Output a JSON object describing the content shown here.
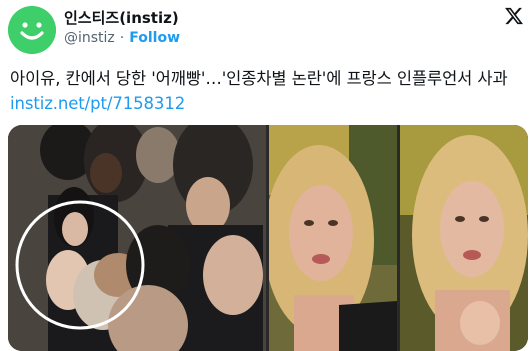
{
  "account": {
    "display_name": "인스티즈(instiz)",
    "handle": "@instiz",
    "separator": "·",
    "follow_label": "Follow",
    "avatar_color": "#3fcf6a"
  },
  "platform_icon": "x-logo-icon",
  "tweet": {
    "text": "아이유, 칸에서 당한 '어깨빵'…'인종차별 논란'에 프랑스 인플루언서 사과 ",
    "link": "instiz.net/pt/7158312",
    "link_color": "#1d9bf0"
  },
  "media": {
    "panels": [
      "crowd-photo-with-circle",
      "influencer-photo",
      "influencer-photo-closeup"
    ]
  }
}
